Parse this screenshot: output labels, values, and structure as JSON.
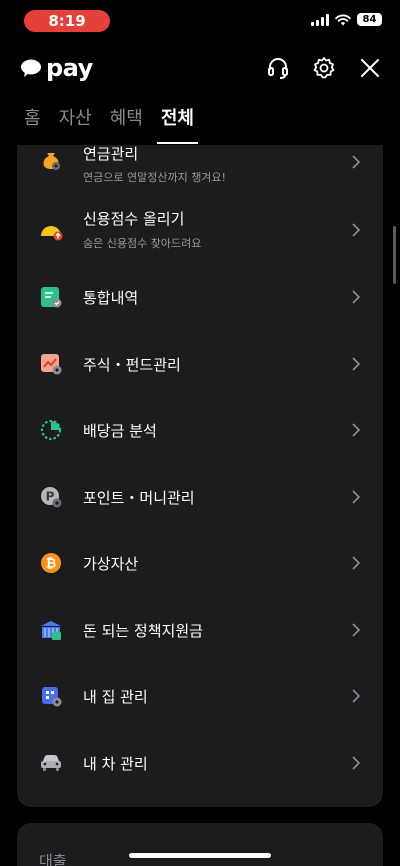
{
  "status_bar": {
    "time": "8:19",
    "battery": "84"
  },
  "header": {
    "logo_text": "pay"
  },
  "tabs": [
    {
      "label": "홈"
    },
    {
      "label": "자산"
    },
    {
      "label": "혜택"
    },
    {
      "label": "전체"
    }
  ],
  "menu": [
    {
      "label": "연금관리",
      "sub": "연금으로 연말정산까지 챙겨요!",
      "icon": "pension-money-bag-icon"
    },
    {
      "label": "신용점수 올리기",
      "sub": "숨은 신용점수 찾아드려요",
      "icon": "credit-score-icon"
    },
    {
      "label": "통합내역",
      "sub": "",
      "icon": "history-document-icon"
    },
    {
      "label": "주식・펀드관리",
      "sub": "",
      "icon": "stock-chart-icon"
    },
    {
      "label": "배당금 분석",
      "sub": "",
      "icon": "pie-chart-icon"
    },
    {
      "label": "포인트・머니관리",
      "sub": "",
      "icon": "point-coin-icon"
    },
    {
      "label": "가상자산",
      "sub": "",
      "icon": "bitcoin-icon"
    },
    {
      "label": "돈 되는 정책지원금",
      "sub": "",
      "icon": "government-building-icon"
    },
    {
      "label": "내 집 관리",
      "sub": "",
      "icon": "house-icon"
    },
    {
      "label": "내 차 관리",
      "sub": "",
      "icon": "car-icon"
    }
  ],
  "next_section": {
    "title": "대출"
  },
  "colors": {
    "accent_red": "#e5413a",
    "card_bg": "#1c1c1e",
    "bitcoin": "#f7931a",
    "green": "#2fbf8a"
  }
}
